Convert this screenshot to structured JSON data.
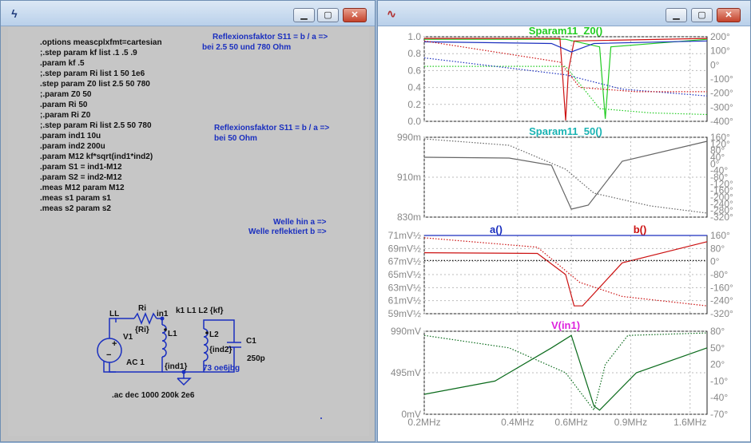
{
  "schematic": {
    "netlist": [
      ".options meascplxfmt=cartesian",
      ";.step param kf list .1 .5 .9",
      ".param kf .5",
      ";.step param Ri list 1 50 1e6",
      ".step param Z0 list 2.5 50 780",
      ";.param Z0 50",
      ".param Ri 50",
      ";.param Ri Z0",
      ";.step param Ri list 2.5 50 780",
      ".param ind1 10u",
      ".param ind2 200u",
      ".param M12 kf*sqrt(ind1*ind2)",
      ".param S1 = ind1-M12",
      ".param S2 = ind2-M12",
      ".meas M12 param M12",
      ".meas s1 param s1",
      ".meas s2 param s2"
    ],
    "comment1_line1": "Reflexionsfaktor S11 = b / a   =>",
    "comment1_line2": "bei 2.5 50 und 780 Ohm",
    "comment2_line1": "Reflexionsfaktor S11 = b / a   =>",
    "comment2_line2": "bei 50 Ohm",
    "wave1": "Welle hin   a   =>",
    "wave2": "Welle reflektiert   b   =>",
    "labels": {
      "ll": "LL",
      "ri": "Ri",
      "ri_val": "{Ri}",
      "in1": "in1",
      "v1": "V1",
      "ac": "AC 1",
      "k": "k1 L1 L2 {kf}",
      "l1": "L1",
      "l2": "L2",
      "ind2": "{ind2}",
      "ind1": "{ind1}",
      "c1": "C1",
      "c1_val": "250p",
      "dot73": "73 oe6jbg",
      "ac_cmd": ".ac dec 1000 200k 2e6"
    }
  },
  "plot": {
    "panes": [
      {
        "title": "Sparam11_Z0()",
        "title_color": "#22cc22",
        "left_ticks": [
          "1.0",
          "0.8",
          "0.6",
          "0.4",
          "0.2",
          "0.0"
        ],
        "right_ticks": [
          "200°",
          "100°",
          "0°",
          "-100°",
          "-200°",
          "-300°",
          "-400°"
        ]
      },
      {
        "title": "Sparam11_50()",
        "title_color": "#19b3b3",
        "left_ticks": [
          "990m",
          "910m",
          "830m"
        ],
        "right_ticks": [
          "160°",
          "120°",
          "80°",
          "40°",
          "0°",
          "-40°",
          "-80°",
          "-120°",
          "-160°",
          "-200°",
          "-240°",
          "-280°",
          "-320°"
        ]
      },
      {
        "title": "a()",
        "title_color": "#1a2fbf",
        "title2": "b()",
        "title2_color": "#cc1111",
        "left_ticks": [
          "71mV½",
          "69mV½",
          "67mV½",
          "65mV½",
          "63mV½",
          "61mV½",
          "59mV½"
        ],
        "right_ticks": [
          "160°",
          "80°",
          "0°",
          "-80°",
          "-160°",
          "-240°",
          "-320°"
        ]
      },
      {
        "title": "V(in1)",
        "title_color": "#dd22dd",
        "left_ticks": [
          "990mV",
          "495mV",
          "0mV"
        ],
        "right_ticks": [
          "80°",
          "50°",
          "20°",
          "-10°",
          "-40°",
          "-70°"
        ]
      }
    ],
    "x_ticks": [
      "0.2MHz",
      "0.4MHz",
      "0.6MHz",
      "0.9MHz",
      "1.6MHz"
    ]
  },
  "colors": {
    "green": "#22cc22",
    "blue": "#1a2fbf",
    "red": "#cc1111",
    "gray": "#888888",
    "darkgreen": "#0b6b1c"
  }
}
